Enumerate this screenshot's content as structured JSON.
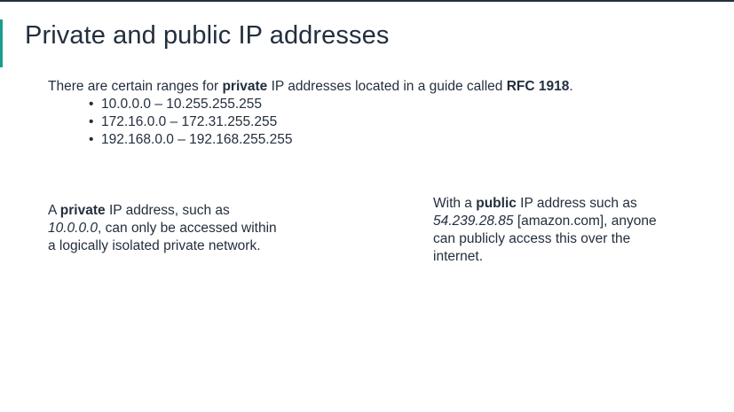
{
  "slide": {
    "title": "Private and public IP addresses"
  },
  "intro": {
    "pre": "There are certain ranges for ",
    "bold": "private",
    "mid": " IP addresses located in a guide called ",
    "rfc": "RFC 1918",
    "post": "."
  },
  "ranges": [
    "10.0.0.0 – 10.255.255.255",
    "172.16.0.0 – 172.31.255.255",
    "192.168.0.0 – 192.168.255.255"
  ],
  "private_note": {
    "pre": "A ",
    "bold": "private",
    "mid": " IP address, such as ",
    "example": "10.0.0.0",
    "post": ", can only be accessed within a logically isolated private network."
  },
  "public_note": {
    "pre": "With a ",
    "bold": "public",
    "mid": " IP address such as ",
    "example": "54.239.28.85",
    "post": " [amazon.com], anyone can publicly access this over the internet."
  },
  "colors": {
    "text": "#232f3e",
    "accent": "#1a9c8e"
  }
}
